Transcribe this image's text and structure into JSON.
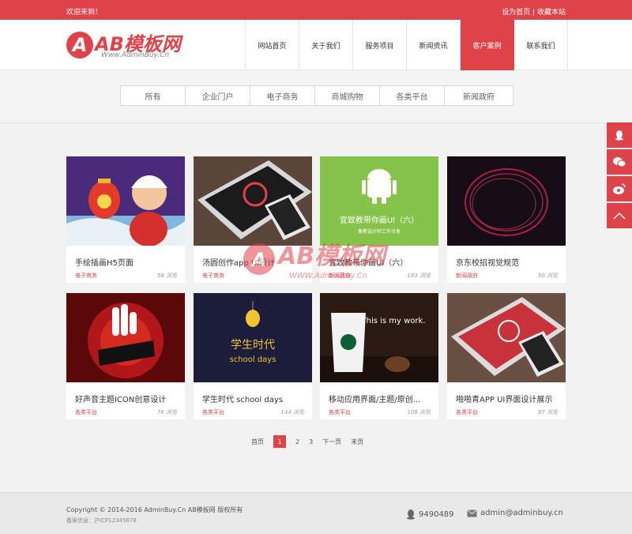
{
  "topbar": {
    "welcome": "欢迎来到！",
    "set_home": "设为首页",
    "sep": " | ",
    "favorite": "收藏本站"
  },
  "logo": {
    "text": "AB模板网",
    "url": "Www.AdminBuy.Cn"
  },
  "nav": [
    {
      "label": "网站首页"
    },
    {
      "label": "关于我们"
    },
    {
      "label": "服务项目"
    },
    {
      "label": "新闻资讯"
    },
    {
      "label": "客户案例",
      "active": true
    },
    {
      "label": "联系我们"
    }
  ],
  "filters": [
    "所有",
    "企业门户",
    "电子商务",
    "商城购物",
    "各类平台",
    "新闻政府"
  ],
  "cards": [
    {
      "title": "手绘插画H5页面",
      "category": "电子商务",
      "views": "58 浏览"
    },
    {
      "title": "汤圆创作app UI设计",
      "category": "电子商务",
      "views": ""
    },
    {
      "title": "宜致教带你画UI（六）",
      "category": "新闻政府",
      "views": "183 浏览",
      "thumb_title": "宜致教带你画UI（六）",
      "thumb_sub": "像素设计师工作分享"
    },
    {
      "title": "京东校招视觉规范",
      "category": "新闻政府",
      "views": "50 浏览"
    },
    {
      "title": "好声音主题ICON创意设计",
      "category": "各类平台",
      "views": "76 浏览"
    },
    {
      "title": "学生时代 school days",
      "category": "各类平台",
      "views": "144 浏览",
      "thumb_title": "学生时代",
      "thumb_sub": "school days"
    },
    {
      "title": "移动应用界面/主题/原创...",
      "category": "各类平台",
      "views": "108 浏览",
      "thumb_title": "This is my work."
    },
    {
      "title": "啪啪青APP UI界面设计展示",
      "category": "各类平台",
      "views": "97 浏览"
    }
  ],
  "pager": {
    "first": "首页",
    "pages": [
      "1",
      "2",
      "3"
    ],
    "next": "下一页",
    "last": "末页"
  },
  "footer": {
    "copyright": "Copyright © 2014-2016 AdminBuy.Cn AB模板网 版权所有",
    "icp": "备案信息：沪ICP12345678",
    "qq": "9490489",
    "email": "admin@adminbuy.cn"
  },
  "watermark": {
    "text": "AB模板网",
    "url": "WWW.AdminBuy.Cn"
  },
  "colors": {
    "accent": "#e0424a",
    "background": "#f2f2f2"
  }
}
